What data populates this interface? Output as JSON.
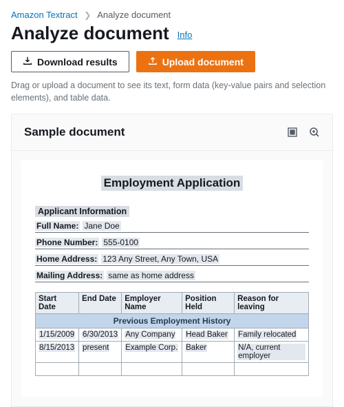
{
  "breadcrumb": {
    "root": "Amazon Textract",
    "current": "Analyze document"
  },
  "page_title": "Analyze document",
  "info_label": "Info",
  "buttons": {
    "download": "Download results",
    "upload": "Upload document"
  },
  "helptext": "Drag or upload a document to see its text, form data (key-value pairs and selection elements), and table data.",
  "panel_title": "Sample document",
  "doc": {
    "title": "Employment Application",
    "section1": "Applicant Information",
    "fields": {
      "full_name_label": "Full Name:",
      "full_name": "Jane Doe",
      "phone_label": "Phone Number:",
      "phone": "555-0100",
      "home_addr_label": "Home Address:",
      "home_addr": "123 Any Street, Any Town, USA",
      "mail_addr_label": "Mailing Address:",
      "mail_addr": " same as home address"
    },
    "table_caption": "Previous Employment History",
    "headers": [
      "Start Date",
      "End Date",
      "Employer Name",
      "Position Held",
      "Reason for leaving"
    ],
    "rows": [
      [
        "1/15/2009",
        "6/30/2013",
        "Any Company",
        "Head Baker",
        "Family relocated"
      ],
      [
        "8/15/2013",
        "present",
        "Example Corp.",
        "Baker",
        "N/A, current employer"
      ]
    ]
  }
}
